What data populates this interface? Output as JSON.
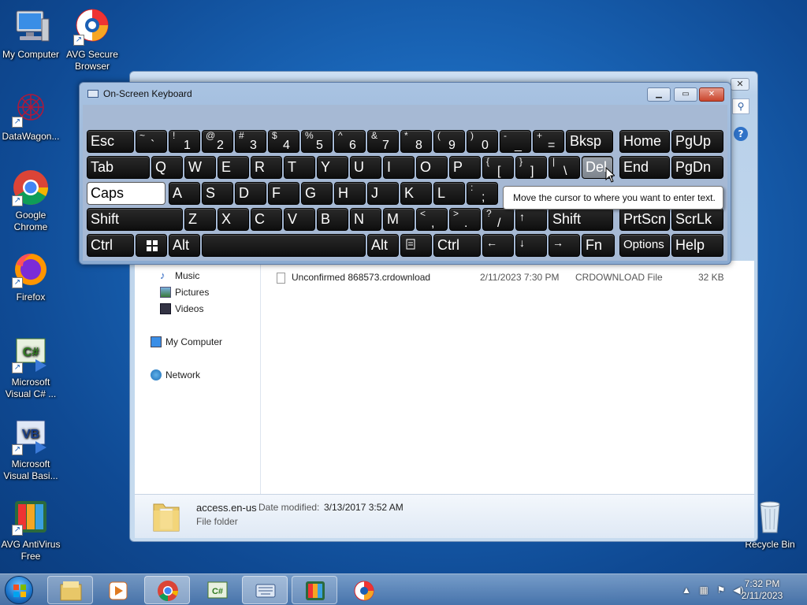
{
  "desktop": {
    "icons": [
      {
        "label": "My Computer"
      },
      {
        "label": "AVG Secure Browser"
      },
      {
        "label": "DataWagon..."
      },
      {
        "label": "Google Chrome"
      },
      {
        "label": "Firefox"
      },
      {
        "label": "Microsoft Visual C# ..."
      },
      {
        "label": "Microsoft Visual Basi..."
      },
      {
        "label": "AVG AntiVirus Free"
      },
      {
        "label": "Recycle Bin"
      }
    ]
  },
  "explorer": {
    "nav_items": [
      "Music",
      "Pictures",
      "Videos",
      "My Computer",
      "Network"
    ],
    "file": {
      "name": "Unconfirmed 868573.crdownload",
      "date": "2/11/2023 7:30 PM",
      "type": "CRDOWNLOAD File",
      "size": "32 KB"
    },
    "details": {
      "name": "access.en-us",
      "date_label": "Date modified:",
      "date_value": "3/13/2017 3:52 AM",
      "kind": "File folder"
    }
  },
  "osk": {
    "title": "On-Screen Keyboard",
    "tooltip": "Move the cursor to where you want to enter text.",
    "rows": [
      [
        {
          "main": "Esc"
        },
        {
          "shift": "~",
          "main": "`"
        },
        {
          "shift": "!",
          "main": "1"
        },
        {
          "shift": "@",
          "main": "2"
        },
        {
          "shift": "#",
          "main": "3"
        },
        {
          "shift": "$",
          "main": "4"
        },
        {
          "shift": "%",
          "main": "5"
        },
        {
          "shift": "^",
          "main": "6"
        },
        {
          "shift": "&",
          "main": "7"
        },
        {
          "shift": "*",
          "main": "8"
        },
        {
          "shift": "(",
          "main": "9"
        },
        {
          "shift": ")",
          "main": "0"
        },
        {
          "shift": "-",
          "main": "_"
        },
        {
          "shift": "+",
          "main": "="
        },
        {
          "main": "Bksp"
        },
        {
          "main": "Home"
        },
        {
          "main": "PgUp"
        }
      ],
      [
        {
          "main": "Tab"
        },
        {
          "main": "Q"
        },
        {
          "main": "W"
        },
        {
          "main": "E"
        },
        {
          "main": "R"
        },
        {
          "main": "T"
        },
        {
          "main": "Y"
        },
        {
          "main": "U"
        },
        {
          "main": "I"
        },
        {
          "main": "O"
        },
        {
          "main": "P"
        },
        {
          "shift": "{",
          "main": "["
        },
        {
          "shift": "}",
          "main": "]"
        },
        {
          "shift": "|",
          "main": "\\"
        },
        {
          "main": "Del"
        },
        {
          "main": "End"
        },
        {
          "main": "PgDn"
        }
      ],
      [
        {
          "main": "Caps"
        },
        {
          "main": "A"
        },
        {
          "main": "S"
        },
        {
          "main": "D"
        },
        {
          "main": "F"
        },
        {
          "main": "G"
        },
        {
          "main": "H"
        },
        {
          "main": "J"
        },
        {
          "main": "K"
        },
        {
          "main": "L"
        },
        {
          "shift": ":",
          "main": ";"
        }
      ],
      [
        {
          "main": "Shift"
        },
        {
          "main": "Z"
        },
        {
          "main": "X"
        },
        {
          "main": "C"
        },
        {
          "main": "V"
        },
        {
          "main": "B"
        },
        {
          "main": "N"
        },
        {
          "main": "M"
        },
        {
          "shift": "<",
          "main": ","
        },
        {
          "shift": ">",
          "main": "."
        },
        {
          "shift": "?",
          "main": "/"
        },
        {
          "main": "↑"
        },
        {
          "main": "Shift"
        },
        {
          "main": "PrtScn"
        },
        {
          "main": "ScrLk"
        }
      ],
      [
        {
          "main": "Ctrl"
        },
        {
          "main": "win-icon"
        },
        {
          "main": "Alt"
        },
        {
          "main": ""
        },
        {
          "main": "Alt"
        },
        {
          "main": "menu-icon"
        },
        {
          "main": "Ctrl"
        },
        {
          "main": "←"
        },
        {
          "main": "↓"
        },
        {
          "main": "→"
        },
        {
          "main": "Fn"
        },
        {
          "main": "Options"
        },
        {
          "main": "Help"
        }
      ]
    ]
  },
  "taskbar": {
    "clock_time": "7:32 PM",
    "clock_date": "2/11/2023"
  }
}
